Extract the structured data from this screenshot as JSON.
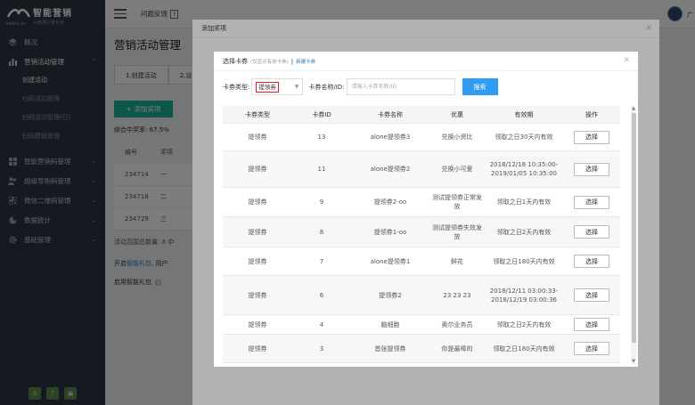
{
  "sidebar": {
    "logo_title": "智能营销",
    "logo_sub": "大数据引擎系统",
    "logo_mini": "midoo.xs",
    "nav": [
      {
        "label": "概况",
        "icon": "dashboard-icon"
      },
      {
        "label": "营销活动管理",
        "icon": "chart-bar-icon",
        "open": true
      },
      {
        "label": "智能营销码管理",
        "icon": "grid-icon"
      },
      {
        "label": "超级导购码管理",
        "icon": "users-icon"
      },
      {
        "label": "微信二维码管理",
        "icon": "qrcode-icon"
      },
      {
        "label": "数据统计",
        "icon": "pie-icon"
      },
      {
        "label": "基础管理",
        "icon": "gear-icon"
      }
    ],
    "sub_items": [
      "创建活动",
      "扫码活动管理",
      "扫码活动管理(已)",
      "扫码模板管理"
    ]
  },
  "topbar": {
    "feedback": "问题反馈",
    "user_short": "广"
  },
  "main": {
    "title": "营销活动管理",
    "steps": [
      "1.创建活动",
      "2.设"
    ],
    "add_button": "添加奖项",
    "ratio": "综合中奖率: 67.5%",
    "table_headers": [
      "编号",
      "奖项"
    ],
    "table_rows": [
      {
        "id": "234714",
        "c": "一"
      },
      {
        "id": "234718",
        "c": "二"
      },
      {
        "id": "234729",
        "c": "三"
      }
    ],
    "foot_prefix": "活动范围总数量:",
    "foot_value": "8",
    "foot_suffix": "中",
    "smart_prefix": "开启",
    "smart_link": "智能礼包",
    "smart_suffix": ", 用户",
    "smart_toggle": "启用智能礼包"
  },
  "outer_modal": {
    "title": "添加奖项"
  },
  "inner_modal": {
    "title": "选择卡券",
    "hint": "(仅显示有效卡券)",
    "separator": "|",
    "new_link": "新建卡券",
    "type_label": "卡券类型:",
    "type_value": "提领券",
    "id_label": "卡券名称/ID:",
    "id_placeholder": "请输入卡券名称/ID",
    "search_button": "搜索",
    "columns": [
      "卡券类型",
      "卡券ID",
      "卡券名称",
      "优惠",
      "有效期",
      "操作"
    ],
    "rows": [
      {
        "type": "提领券",
        "id": "13",
        "name": "alone提领券3",
        "benefit": "兑换小资比",
        "validity": "领取之日30天内有效",
        "action": "选择",
        "h": 31
      },
      {
        "type": "提领券",
        "id": "11",
        "name": "alone提领券2",
        "benefit": "兑换小可爱",
        "validity": "2018/12/18 10:35:00-2019/01/05 10:35:00",
        "action": "选择",
        "h": 41
      },
      {
        "type": "提领券",
        "id": "9",
        "name": "提领券2-oo",
        "benefit": "测试提领券正常发放",
        "validity": "领取之日1天内有效",
        "action": "选择",
        "h": 33
      },
      {
        "type": "提领券",
        "id": "8",
        "name": "提领券1-oo",
        "benefit": "测试提领券失效发放",
        "validity": "领取之日2天内有效",
        "action": "选择",
        "h": 34
      },
      {
        "type": "提领券",
        "id": "7",
        "name": "alone提领券1",
        "benefit": "鲜花",
        "validity": "领取之日180天内有效",
        "action": "选择",
        "h": 32
      },
      {
        "type": "提领券",
        "id": "6",
        "name": "提领券2",
        "benefit": "23 23 23",
        "validity": "2018/12/11 03:00:33-2018/12/19 03:00:36",
        "action": "选择",
        "h": 44
      },
      {
        "type": "提领券",
        "id": "4",
        "name": "脑细胞",
        "benefit": "奥尔业务员",
        "validity": "领取之日2天内有效",
        "action": "选择",
        "h": 22
      },
      {
        "type": "提领券",
        "id": "3",
        "name": "首张提领券",
        "benefit": "你是最棒的",
        "validity": "领取之日180天内有效",
        "action": "选择",
        "h": 32
      }
    ]
  }
}
